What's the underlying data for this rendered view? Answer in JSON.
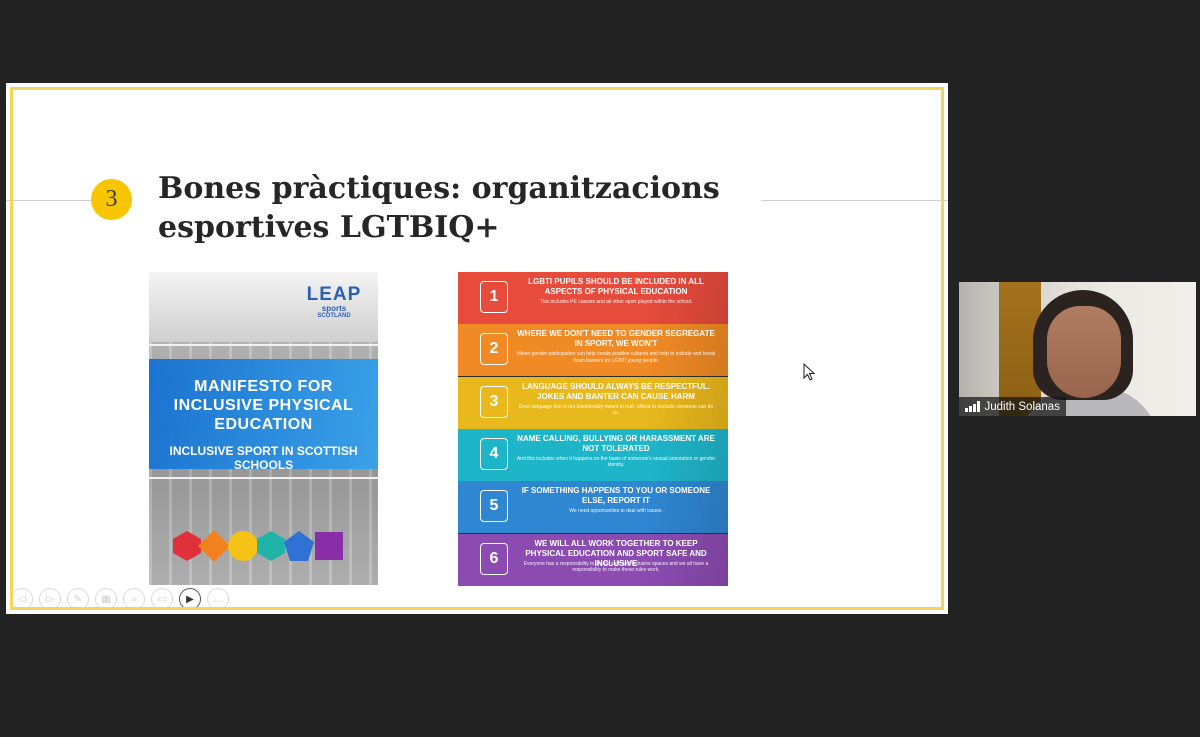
{
  "slide": {
    "step_number": "3",
    "title": "Bones pràctiques: organitzacions esportives LGTBIQ+",
    "accent_color": "#f7c600",
    "frame_color": "#f2d659"
  },
  "poster": {
    "logo_brand": "LEAP",
    "logo_sub1": "sports",
    "logo_sub2": "SCOTLAND",
    "heading": "MANIFESTO FOR INCLUSIVE PHYSICAL EDUCATION",
    "subheading": "INCLUSIVE SPORT IN SCOTTISH SCHOOLS"
  },
  "rules": [
    {
      "number": "1",
      "color": "#e64b3c",
      "headline": "LGBTI pupils should be included in all aspects of physical education",
      "body": "This includes PE classes and all other sport played within the school."
    },
    {
      "number": "2",
      "color": "#f08a24",
      "headline": "Where we don't need to gender segregate in sport, we won't",
      "body": "Mixed gender participation can help create positive cultures and help to include and break down barriers for LGBTI young people."
    },
    {
      "number": "3",
      "color": "#e9b81c",
      "headline": "Language should always be respectful. Jokes and banter can cause harm",
      "body": "Even language that is not intentionally meant to hurt, offend or exclude someone can do so."
    },
    {
      "number": "4",
      "color": "#1fb5c9",
      "headline": "Name calling, bullying or harassment are not tolerated",
      "body": "And this includes when it happens on the basis of someone's sexual orientation or gender identity."
    },
    {
      "number": "5",
      "color": "#2f86d1",
      "headline": "If something happens to you or someone else, report it",
      "body": "We need opportunities to deal with issues."
    },
    {
      "number": "6",
      "color": "#8b4bb1",
      "headline": "We will all work together to keep physical education and sport safe and inclusive",
      "body": "Everyone has a responsibility to create safe and inclusive spaces and we all have a responsibility to make these rules work."
    }
  ],
  "slide_controls": [
    {
      "icon": "prev-icon",
      "glyph": "◁"
    },
    {
      "icon": "next-icon",
      "glyph": "▷"
    },
    {
      "icon": "pen-icon",
      "glyph": "✎"
    },
    {
      "icon": "grid-icon",
      "glyph": "▦"
    },
    {
      "icon": "zoom-icon",
      "glyph": "⌕"
    },
    {
      "icon": "subtitles-icon",
      "glyph": "▭"
    },
    {
      "icon": "video-icon",
      "glyph": "▶"
    },
    {
      "icon": "more-icon",
      "glyph": "…"
    }
  ],
  "participant": {
    "name": "Judith Solanas"
  }
}
